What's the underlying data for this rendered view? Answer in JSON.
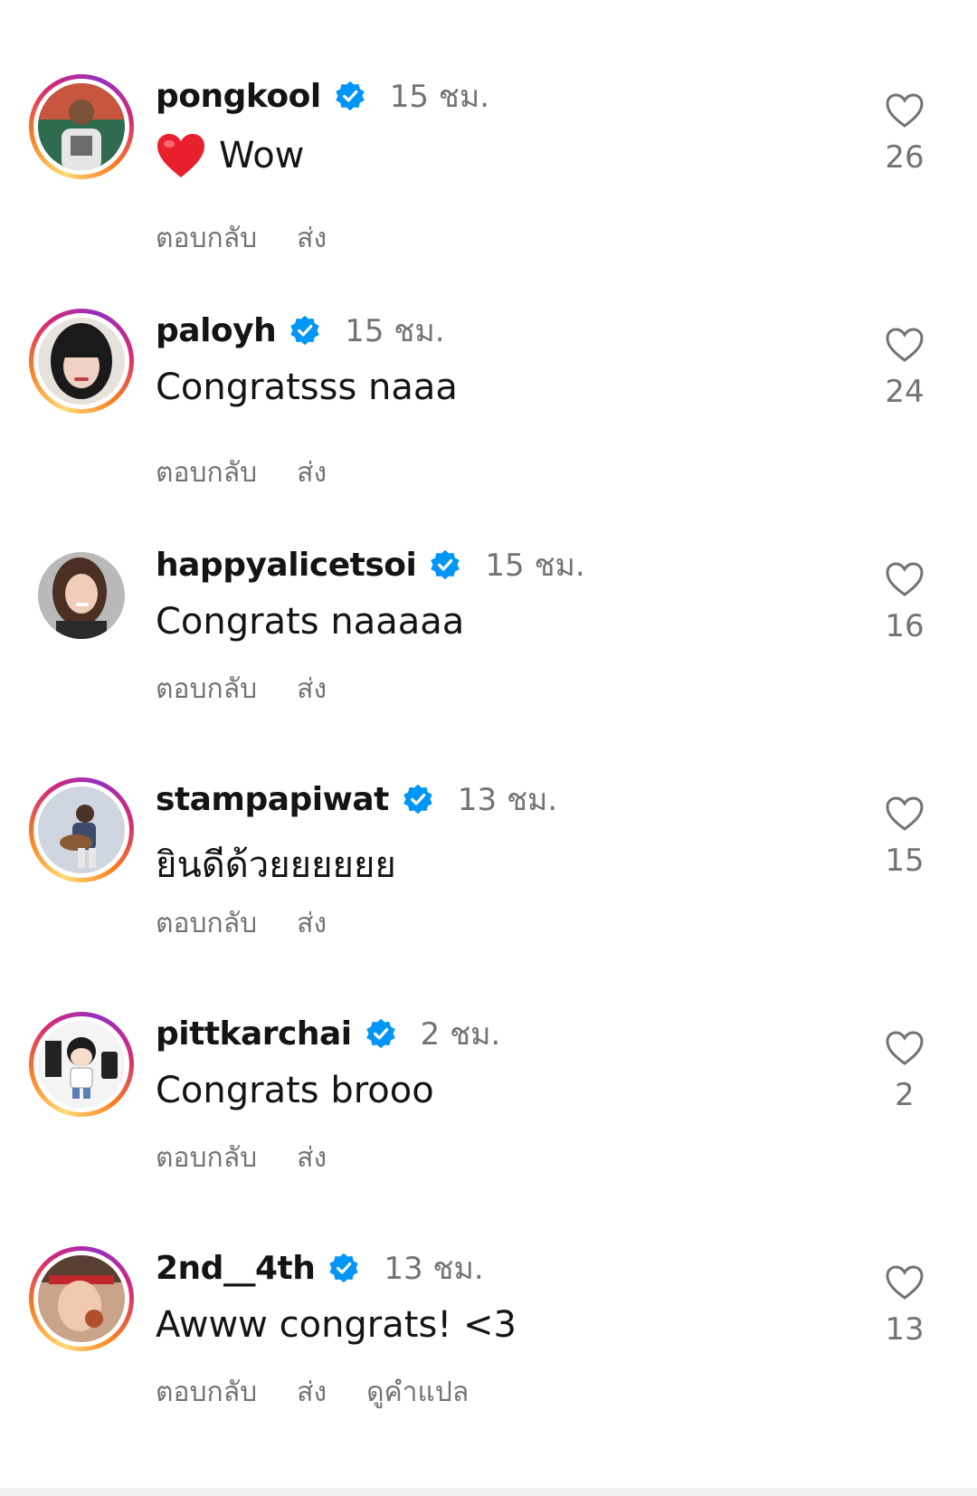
{
  "comments": [
    {
      "username": "pongkool",
      "time": "15 ชม.",
      "text": "Wow",
      "has_heart_emoji": true,
      "actions": [
        "ตอบกลับ",
        "ส่ง"
      ],
      "likes": "26",
      "avatar_bg": "#2f6b4f"
    },
    {
      "username": "paloyh",
      "time": "15 ชม.",
      "text": "Congratsss naaa",
      "actions": [
        "ตอบกลับ",
        "ส่ง"
      ],
      "likes": "24",
      "avatar_bg": "#e8e2dc"
    },
    {
      "username": "happyalicetsoi",
      "time": "15 ชม.",
      "text": "Congrats naaaaa",
      "actions": [
        "ตอบกลับ",
        "ส่ง"
      ],
      "likes": "16",
      "avatar_bg": "#b9b9b9"
    },
    {
      "username": "stampapiwat",
      "time": "13 ชม.",
      "text": "ยินดีด้วยยยยยย",
      "actions": [
        "ตอบกลับ",
        "ส่ง"
      ],
      "likes": "15",
      "avatar_bg": "#cfd6df"
    },
    {
      "username": "pittkarchai",
      "time": "2 ชม.",
      "text": "Congrats brooo",
      "actions": [
        "ตอบกลับ",
        "ส่ง"
      ],
      "likes": "2",
      "avatar_bg": "#f4f4f4"
    },
    {
      "username": "2nd__4th",
      "time": "13 ชม.",
      "text": "Awww congrats! <3",
      "actions": [
        "ตอบกลับ",
        "ส่ง",
        "ดูคำแปล"
      ],
      "likes": "13",
      "avatar_bg": "#c9a48a"
    }
  ],
  "colors": {
    "verified": "#0095f6",
    "secondary_text": "#737373",
    "primary_text": "#141414",
    "heart_emoji": "#e8202e"
  }
}
